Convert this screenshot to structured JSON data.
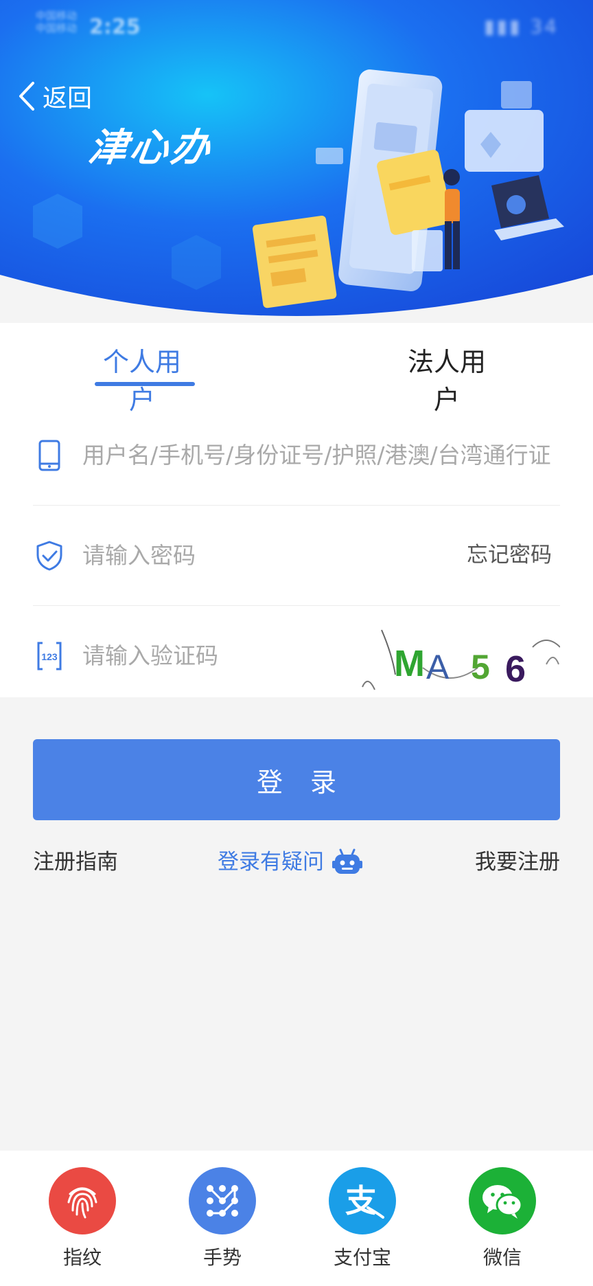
{
  "status_bar": {
    "carrier_line1": "中国移动",
    "carrier_line2": "中国移动",
    "time": "2:25",
    "battery": "34"
  },
  "header": {
    "back_label": "返回",
    "brand": "津心办"
  },
  "tabs": [
    {
      "label": "个人用户",
      "active": true
    },
    {
      "label": "法人用户",
      "active": false
    }
  ],
  "form": {
    "username_placeholder": "用户名/手机号/身份证号/护照/港澳/台湾通行证",
    "password_placeholder": "请输入密码",
    "forgot_label": "忘记密码",
    "captcha_placeholder": "请输入验证码",
    "captcha_text": "MA56"
  },
  "actions": {
    "login_label": "登录",
    "guide_label": "注册指南",
    "help_label": "登录有疑问",
    "register_label": "我要注册"
  },
  "quick_login": [
    {
      "label": "指纹",
      "icon": "fingerprint-icon",
      "color": "#ea4a43"
    },
    {
      "label": "手势",
      "icon": "gesture-icon",
      "color": "#4b82e6"
    },
    {
      "label": "支付宝",
      "icon": "alipay-icon",
      "color": "#1a9ee8"
    },
    {
      "label": "微信",
      "icon": "wechat-icon",
      "color": "#1cb137"
    }
  ],
  "colors": {
    "accent": "#3f7be3",
    "button": "#4b82e6",
    "banner_blue": "#1a5be8"
  }
}
